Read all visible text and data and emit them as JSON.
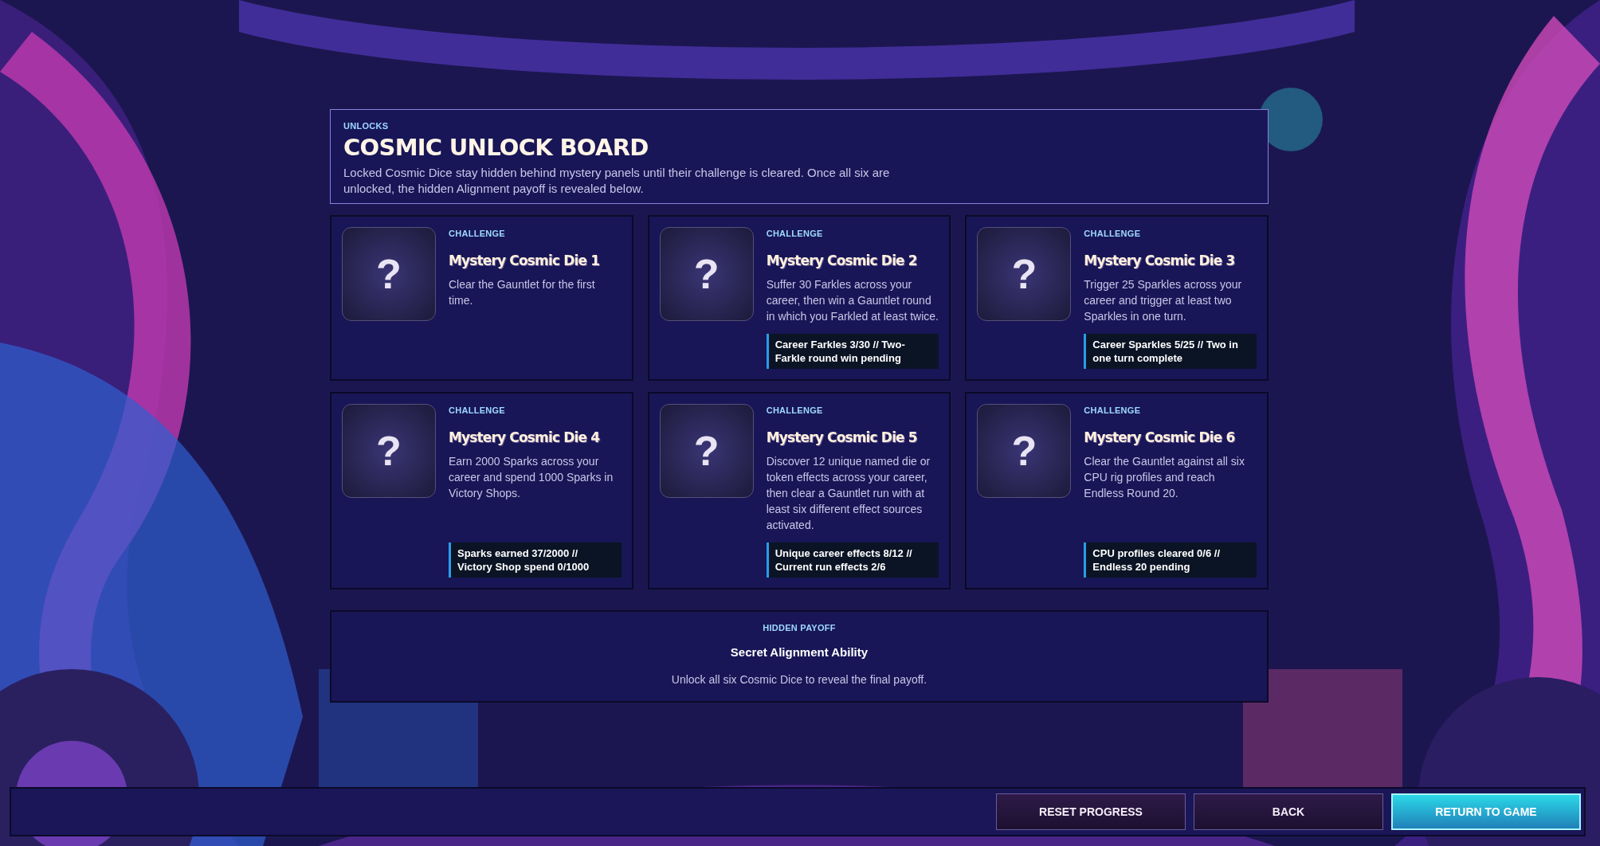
{
  "header": {
    "eyebrow": "UNLOCKS",
    "title": "COSMIC UNLOCK BOARD",
    "description": "Locked Cosmic Dice stay hidden behind mystery panels until their challenge is cleared. Once all six are unlocked, the hidden Alignment payoff is revealed below."
  },
  "cards": [
    {
      "glyph": "?",
      "eyebrow": "CHALLENGE",
      "title": "Mystery Cosmic Die 1",
      "description": "Clear the Gauntlet for the first time."
    },
    {
      "glyph": "?",
      "eyebrow": "CHALLENGE",
      "title": "Mystery Cosmic Die 2",
      "description": "Suffer 30 Farkles across your career, then win a Gauntlet round in which you Farkled at least twice.",
      "progress": "Career Farkles 3/30 // Two-Farkle round win pending"
    },
    {
      "glyph": "?",
      "eyebrow": "CHALLENGE",
      "title": "Mystery Cosmic Die 3",
      "description": "Trigger 25 Sparkles across your career and trigger at least two Sparkles in one turn.",
      "progress": "Career Sparkles 5/25 // Two in one turn complete"
    },
    {
      "glyph": "?",
      "eyebrow": "CHALLENGE",
      "title": "Mystery Cosmic Die 4",
      "description": "Earn 2000 Sparks across your career and spend 1000 Sparks in Victory Shops.",
      "progress": "Sparks earned 37/2000 // Victory Shop spend 0/1000"
    },
    {
      "glyph": "?",
      "eyebrow": "CHALLENGE",
      "title": "Mystery Cosmic Die 5",
      "description": "Discover 12 unique named die or token effects across your career, then clear a Gauntlet run with at least six different effect sources activated.",
      "progress": "Unique career effects 8/12 // Current run effects 2/6"
    },
    {
      "glyph": "?",
      "eyebrow": "CHALLENGE",
      "title": "Mystery Cosmic Die 6",
      "description": "Clear the Gauntlet against all six CPU rig profiles and reach Endless Round 20.",
      "progress": "CPU profiles cleared 0/6 // Endless 20 pending"
    }
  ],
  "payoff": {
    "eyebrow": "HIDDEN PAYOFF",
    "title": "Secret Alignment Ability",
    "description": "Unlock all six Cosmic Dice to reveal the final payoff."
  },
  "buttons": [
    {
      "label": "RESET PROGRESS",
      "kind": "secondary"
    },
    {
      "label": "BACK",
      "kind": "secondary"
    },
    {
      "label": "RETURN TO GAME",
      "kind": "primary"
    }
  ]
}
